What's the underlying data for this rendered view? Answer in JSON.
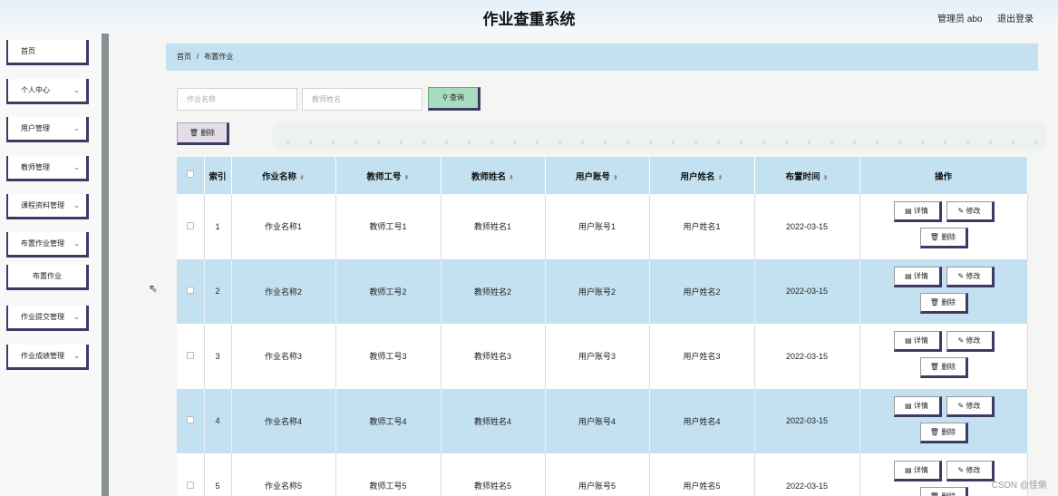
{
  "header": {
    "title": "作业查重系统",
    "admin": "管理员 abo",
    "logout": "退出登录"
  },
  "sidebar": {
    "items": [
      {
        "label": "首页",
        "chevron": ""
      },
      {
        "label": "个人中心",
        "chevron": "⌄"
      },
      {
        "label": "用户管理",
        "chevron": "⌄"
      },
      {
        "label": "教师管理",
        "chevron": "⌄"
      },
      {
        "label": "课程资料管理",
        "chevron": "⌄"
      },
      {
        "label": "布置作业管理",
        "chevron": "⌄"
      },
      {
        "label": "布置作业",
        "chevron": ""
      },
      {
        "label": "作业提交管理",
        "chevron": "⌄"
      },
      {
        "label": "作业成绩管理",
        "chevron": "⌄"
      }
    ]
  },
  "breadcrumb": {
    "home": "首页",
    "separator": "/",
    "current": "布置作业"
  },
  "search": {
    "name_placeholder": "作业名称",
    "teacher_placeholder": "教师姓名",
    "query_label": "查询"
  },
  "toolbar": {
    "delete_label": "删除"
  },
  "table": {
    "headers": [
      "索引",
      "作业名称",
      "教师工号",
      "教师姓名",
      "用户账号",
      "用户姓名",
      "布置时间",
      "操作"
    ],
    "rows": [
      [
        "1",
        "作业名称1",
        "教师工号1",
        "教师姓名1",
        "用户账号1",
        "用户姓名1",
        "2022-03-15"
      ],
      [
        "2",
        "作业名称2",
        "教师工号2",
        "教师姓名2",
        "用户账号2",
        "用户姓名2",
        "2022-03-15"
      ],
      [
        "3",
        "作业名称3",
        "教师工号3",
        "教师姓名3",
        "用户账号3",
        "用户姓名3",
        "2022-03-15"
      ],
      [
        "4",
        "作业名称4",
        "教师工号4",
        "教师姓名4",
        "用户账号4",
        "用户姓名4",
        "2022-03-15"
      ],
      [
        "5",
        "作业名称5",
        "教师工号5",
        "教师姓名5",
        "用户账号5",
        "用户姓名5",
        "2022-03-15"
      ]
    ],
    "actions": {
      "detail": "详情",
      "edit": "修改",
      "delete": "删除"
    }
  },
  "watermark": "CSDN @佳偷",
  "colors": {
    "accent_blue": "#c3e1f0",
    "query_green": "#a6dcc0",
    "button_border": "#3d3b66"
  }
}
